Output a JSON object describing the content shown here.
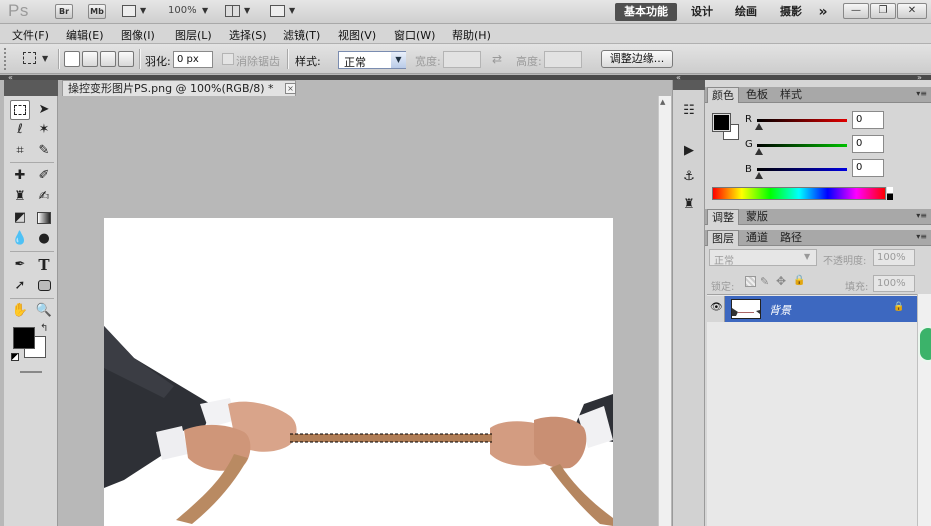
{
  "app_bar": {
    "logo": "Ps",
    "bridge_label": "Br",
    "minibridge_label": "Mb",
    "zoom_value": "100%",
    "workspaces": [
      "基本功能",
      "设计",
      "绘画",
      "摄影"
    ],
    "more_glyph": "»"
  },
  "menu": [
    "文件(F)",
    "编辑(E)",
    "图像(I)",
    "图层(L)",
    "选择(S)",
    "滤镜(T)",
    "视图(V)",
    "窗口(W)",
    "帮助(H)"
  ],
  "options_bar": {
    "feather_label": "羽化:",
    "feather_value": "0 px",
    "antialias_label": "消除锯齿",
    "style_label": "样式:",
    "style_value": "正常",
    "width_label": "宽度:",
    "height_label": "高度:",
    "refine_edge_button": "调整边缘..."
  },
  "document": {
    "tab_title": "操控变形图片PS.png @ 100%(RGB/8) *",
    "close_glyph": "×"
  },
  "color_panel": {
    "tabs": [
      "颜色",
      "色板",
      "样式"
    ],
    "channels": [
      {
        "label": "R",
        "value": "0"
      },
      {
        "label": "G",
        "value": "0"
      },
      {
        "label": "B",
        "value": "0"
      }
    ],
    "foreground_color": "#000000",
    "background_color": "#ffffff"
  },
  "adjustments_panel": {
    "tabs": [
      "调整",
      "蒙版"
    ]
  },
  "layers_panel": {
    "tabs": [
      "图层",
      "通道",
      "路径"
    ],
    "blend_mode": "正常",
    "opacity_label": "不透明度:",
    "opacity_value": "100%",
    "lock_label": "锁定:",
    "fill_label": "填充:",
    "fill_value": "100%",
    "layers": [
      {
        "name": "背景",
        "visible": true,
        "locked": true,
        "selected": true
      }
    ]
  },
  "colors": {
    "accent_selected_layer": "#3d68c0",
    "workspace_active": "#4f4f4f",
    "canvas_bg": "#b8b8b8"
  }
}
